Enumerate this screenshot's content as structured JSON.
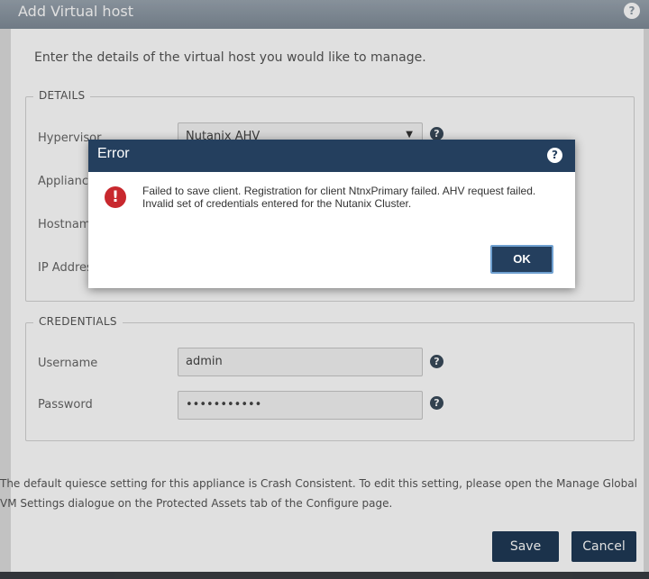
{
  "dialog": {
    "title": "Add Virtual host",
    "help_glyph": "?",
    "intro": "Enter the details of the virtual host you would like to manage."
  },
  "details": {
    "legend": "DETAILS",
    "hypervisor_label": "Hypervisor",
    "hypervisor_value": "Nutanix AHV",
    "appliance_label": "Applianc",
    "hostname_label": "Hostnam",
    "ip_label": "IP Addres"
  },
  "credentials": {
    "legend": "CREDENTIALS",
    "username_label": "Username",
    "username_value": "admin",
    "password_label": "Password",
    "password_value": "•••••••••••"
  },
  "note": "The default quiesce setting for this appliance is Crash Consistent. To edit this setting, please open the Manage Global VM Settings dialogue on the Protected Assets tab of the Configure page.",
  "buttons": {
    "save": "Save",
    "cancel": "Cancel"
  },
  "error_dialog": {
    "title": "Error",
    "help_glyph": "?",
    "icon_glyph": "!",
    "message": "Failed to save client. Registration for client NtnxPrimary failed. AHV request failed. Invalid set of credentials entered for the Nutanix Cluster.",
    "ok": "OK"
  },
  "icons": {
    "help": "question-circle-icon",
    "error": "exclamation-circle-icon",
    "dropdown": "caret-down-icon",
    "caret_glyph": "▼"
  },
  "colors": {
    "titlebar": "#243f5e",
    "button": "#1f3a56",
    "error_icon": "#c8282e",
    "ok_border": "#6fa0d0"
  }
}
